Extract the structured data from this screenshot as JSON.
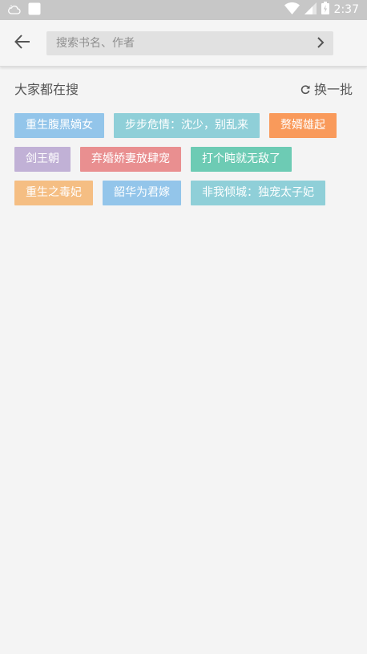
{
  "status_bar": {
    "time": "2:37",
    "icons": [
      "weather-cloud-icon",
      "app-notification-icon",
      "wifi-icon",
      "signal-icon",
      "battery-charging-icon"
    ]
  },
  "toolbar": {
    "back_icon": "arrow-left-icon",
    "search_placeholder": "搜索书名、作者",
    "search_go_icon": "chevron-right-icon"
  },
  "hot_search": {
    "title": "大家都在搜",
    "refresh_label": "换一批",
    "refresh_icon": "refresh-icon",
    "rows": [
      [
        {
          "label": "重生腹黑嫡女",
          "color": "#93c5ea"
        },
        {
          "label": "步步危情：沈少，别乱来",
          "color": "#8fcfd8"
        },
        {
          "label": "赘婿雄起",
          "color": "#f99a5b"
        }
      ],
      [
        {
          "label": "剑王朝",
          "color": "#c1b1d6"
        },
        {
          "label": "弃婚娇妻放肆宠",
          "color": "#e98f90"
        },
        {
          "label": "打个盹就无敌了",
          "color": "#6dcbb4"
        }
      ],
      [
        {
          "label": "重生之毒妃",
          "color": "#f5be83"
        },
        {
          "label": "韶华为君嫁",
          "color": "#93c5ea"
        },
        {
          "label": "非我倾城：独宠太子妃",
          "color": "#8fcfd8"
        }
      ]
    ]
  }
}
